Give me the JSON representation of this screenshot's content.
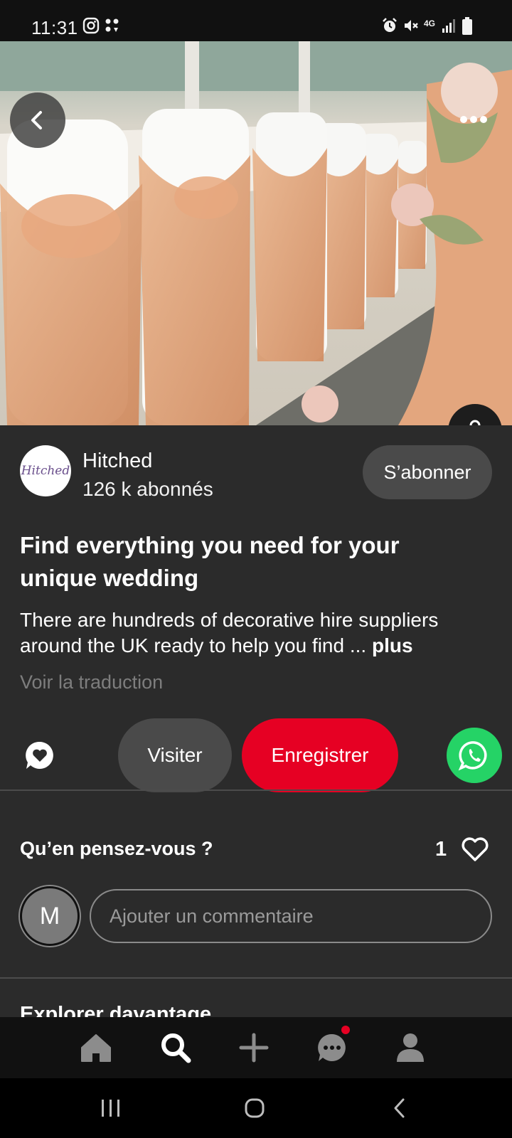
{
  "status_bar": {
    "time": "11:31",
    "network": "4G",
    "icons": [
      "instagram-icon",
      "notification-icon",
      "alarm-icon",
      "mute-icon",
      "signal-icon",
      "battery-icon"
    ]
  },
  "hero": {
    "icons": {
      "back": "chevron-left-icon",
      "more": "more-dots-icon",
      "shop": "shopping-bag-icon"
    }
  },
  "creator": {
    "logo_text": "Hitched",
    "name": "Hitched",
    "followers": "126 k abonnés",
    "follow_label": "S’abonner"
  },
  "pin": {
    "title": "Find everything you need for your unique wedding",
    "description": "There are hundreds of decorative hire suppliers around the UK ready to help you find ... ",
    "more_label": "plus",
    "translate_label": "Voir la traduction"
  },
  "actions": {
    "visit_label": "Visiter",
    "save_label": "Enregistrer",
    "save_color": "#e60023",
    "whatsapp_color": "#25d366"
  },
  "comments": {
    "heading": "Qu’en pensez-vous ?",
    "like_count": "1",
    "user_initial": "M",
    "input_placeholder": "Ajouter un commentaire"
  },
  "explore": {
    "heading": "Explorer davantage"
  },
  "bottom_nav": {
    "items": [
      "home-icon",
      "search-icon",
      "plus-icon",
      "messages-icon",
      "profile-icon"
    ]
  },
  "system_nav": {
    "items": [
      "recents-icon",
      "home-circle-icon",
      "back-icon"
    ]
  }
}
